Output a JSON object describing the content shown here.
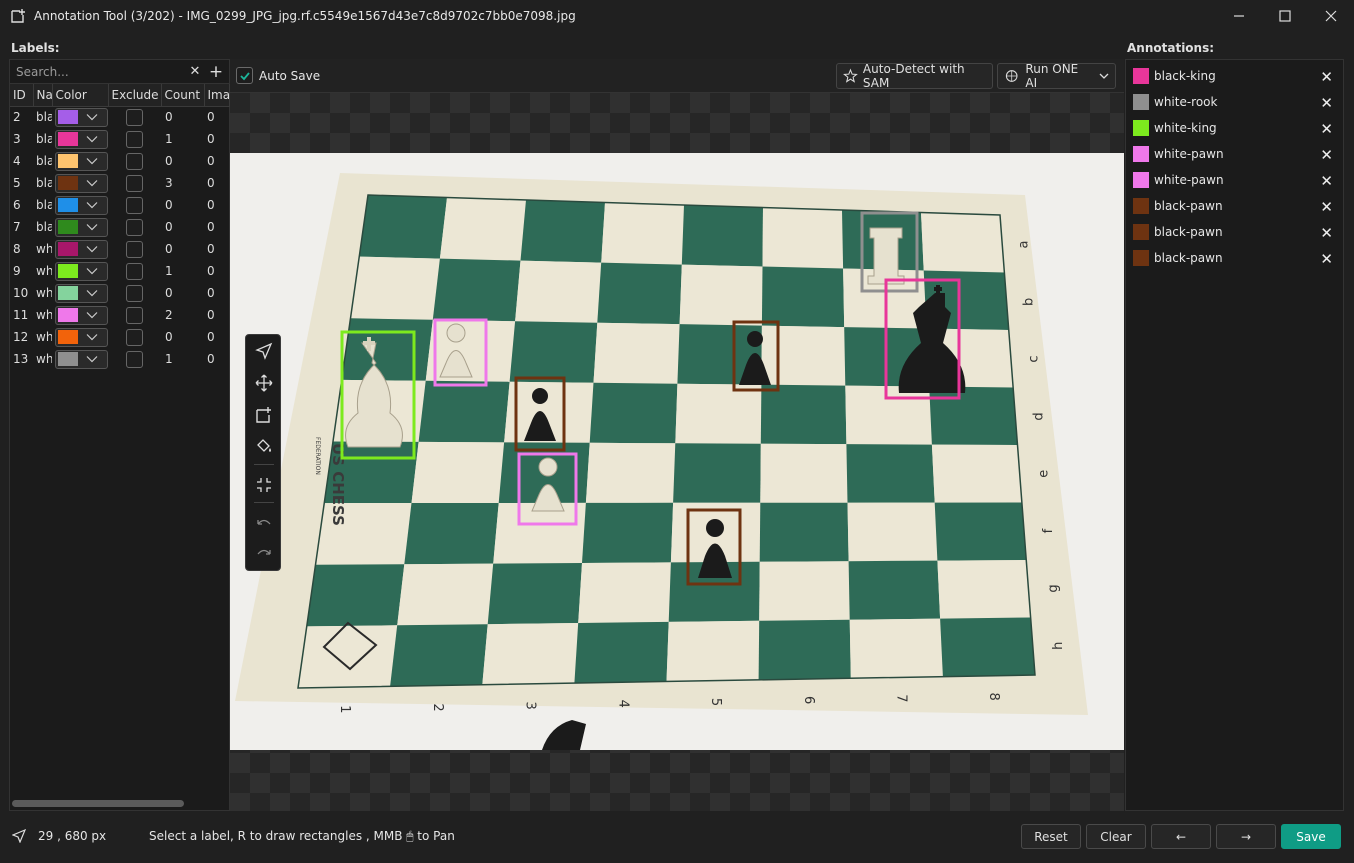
{
  "window": {
    "title": "Annotation Tool (3/202) - IMG_0299_JPG_jpg.rf.c5549e1567d43e7c8d9702c7bb0e7098.jpg"
  },
  "labels_panel": {
    "heading": "Labels:",
    "search_placeholder": "Search...",
    "columns": [
      "ID",
      "Na",
      "Color",
      "Exclude",
      "Count",
      "Ima"
    ],
    "rows": [
      {
        "id": "2",
        "name": "bla",
        "color": "#a55ee8",
        "count": "0",
        "images": "0"
      },
      {
        "id": "3",
        "name": "bla",
        "color": "#e8369a",
        "count": "1",
        "images": "0"
      },
      {
        "id": "4",
        "name": "bla",
        "color": "#ffc46e",
        "count": "0",
        "images": "0"
      },
      {
        "id": "5",
        "name": "bla",
        "color": "#6e3311",
        "count": "3",
        "images": "0"
      },
      {
        "id": "6",
        "name": "bla",
        "color": "#1f8fe8",
        "count": "0",
        "images": "0"
      },
      {
        "id": "7",
        "name": "bla",
        "color": "#2f8a1d",
        "count": "0",
        "images": "0"
      },
      {
        "id": "8",
        "name": "wh",
        "color": "#a8176a",
        "count": "0",
        "images": "0"
      },
      {
        "id": "9",
        "name": "wh",
        "color": "#7dea1e",
        "count": "1",
        "images": "0"
      },
      {
        "id": "10",
        "name": "wh",
        "color": "#84d39d",
        "count": "0",
        "images": "0"
      },
      {
        "id": "11",
        "name": "wh",
        "color": "#ef78ea",
        "count": "2",
        "images": "0"
      },
      {
        "id": "12",
        "name": "wh",
        "color": "#f2630b",
        "count": "0",
        "images": "0"
      },
      {
        "id": "13",
        "name": "wh",
        "color": "#8f8f8f",
        "count": "1",
        "images": "0"
      }
    ]
  },
  "toolbar": {
    "auto_save_label": "Auto Save",
    "auto_detect_label": "Auto-Detect with SAM",
    "run_ai_label": "Run ONE AI"
  },
  "canvas": {
    "board_rank_labels": [
      "1",
      "2",
      "3",
      "4",
      "5",
      "6",
      "7",
      "8"
    ],
    "board_file_labels": [
      "a",
      "b",
      "c",
      "d",
      "e",
      "f",
      "g",
      "h"
    ],
    "board_brand": "US CHESS",
    "board_brand_sub": "FEDERATION"
  },
  "annotations_panel": {
    "heading": "Annotations:",
    "items": [
      {
        "label": "black-king",
        "color": "#e8369a"
      },
      {
        "label": "white-rook",
        "color": "#8f8f8f"
      },
      {
        "label": "white-king",
        "color": "#7dea1e"
      },
      {
        "label": "white-pawn",
        "color": "#ef78ea"
      },
      {
        "label": "white-pawn",
        "color": "#ef78ea"
      },
      {
        "label": "black-pawn",
        "color": "#6e3311"
      },
      {
        "label": "black-pawn",
        "color": "#6e3311"
      },
      {
        "label": "black-pawn",
        "color": "#6e3311"
      }
    ]
  },
  "statusbar": {
    "coords": "29 , 680 px",
    "hint": "Select a label, R to draw rectangles , MMB 🖱 to Pan",
    "reset_label": "Reset",
    "clear_label": "Clear",
    "prev_label": "←",
    "next_label": "→",
    "save_label": "Save"
  }
}
